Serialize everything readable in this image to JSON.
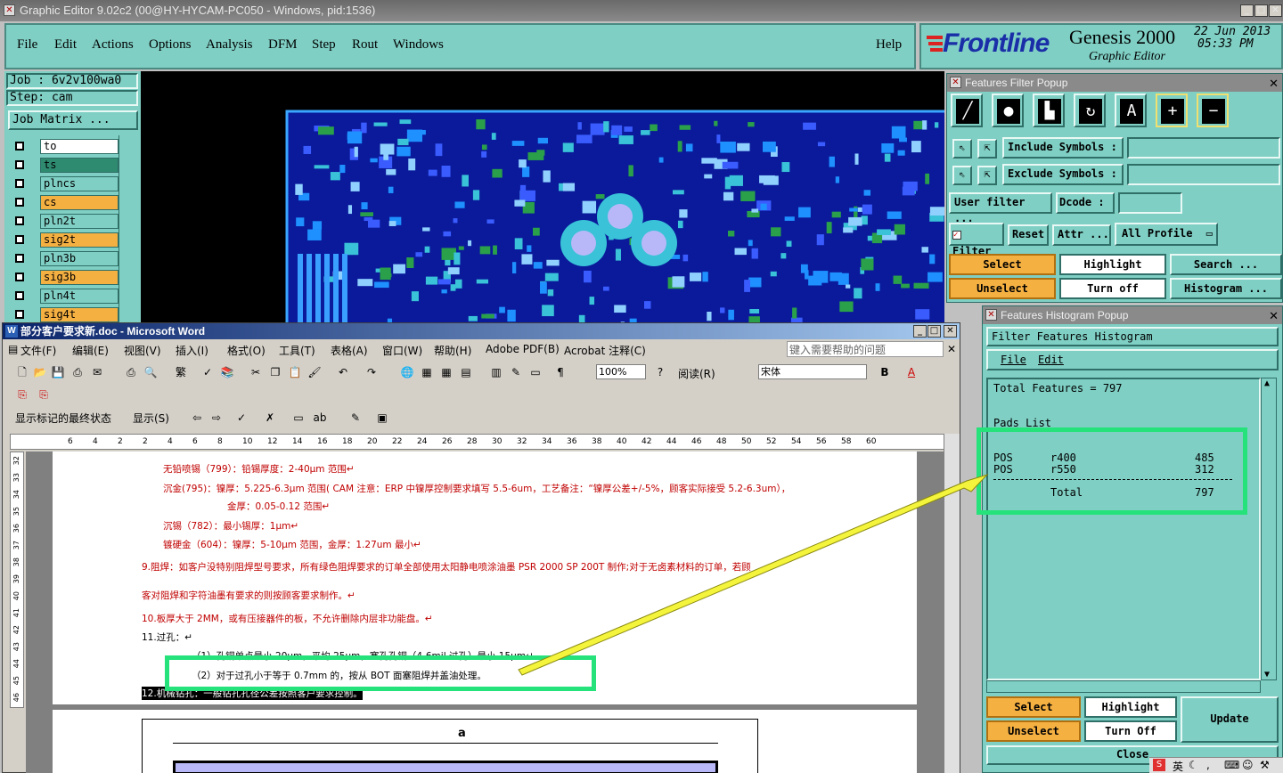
{
  "genesis": {
    "title": "Graphic Editor 9.02c2 (00@HY-HYCAM-PC050 - Windows, pid:1536)",
    "menu": [
      "File",
      "Edit",
      "Actions",
      "Options",
      "Analysis",
      "DFM",
      "Step",
      "Rout",
      "Windows"
    ],
    "help": "Help",
    "logo": "Frontline",
    "product": "Genesis 2000",
    "subtitle": "Graphic Editor",
    "date": "22 Jun 2013",
    "time": "05:33 PM",
    "job": "Job : 6v2v100wa0",
    "step": "Step: cam",
    "job_matrix": "Job Matrix ...",
    "layers": [
      {
        "name": "to",
        "color": "#ffffff"
      },
      {
        "name": "ts",
        "color": "#2e8b70"
      },
      {
        "name": "plncs",
        "color": "#7fcfc4"
      },
      {
        "name": "cs",
        "color": "#f5b042"
      },
      {
        "name": "pln2t",
        "color": "#7fcfc4"
      },
      {
        "name": "sig2t",
        "color": "#f5b042"
      },
      {
        "name": "pln3b",
        "color": "#7fcfc4"
      },
      {
        "name": "sig3b",
        "color": "#f5b042"
      },
      {
        "name": "pln4t",
        "color": "#7fcfc4"
      },
      {
        "name": "sig4t",
        "color": "#f5b042"
      }
    ]
  },
  "filter_popup": {
    "title": "Features Filter Popup",
    "include": "Include Symbols :",
    "exclude": "Exclude Symbols :",
    "user_filter": "User filter ...",
    "dcode": "Dcode :",
    "filter": "Filter",
    "reset": "Reset",
    "attr": "Attr ...",
    "profile": "All Profile",
    "select": "Select",
    "highlight": "Highlight",
    "search": "Search ...",
    "unselect": "Unselect",
    "turn_off": "Turn off",
    "histogram": "Histogram ..."
  },
  "histogram_popup": {
    "title": "Features Histogram Popup",
    "header": "Filter Features Histogram",
    "menu": [
      "File",
      "Edit"
    ],
    "total_line": "Total Features = 797",
    "pads_list": "Pads List",
    "rows": [
      {
        "type": "POS",
        "symbol": "r400",
        "count": "485"
      },
      {
        "type": "POS",
        "symbol": "r550",
        "count": "312"
      }
    ],
    "total_label": "Total",
    "total_value": "797",
    "select": "Select",
    "highlight": "Highlight",
    "update": "Update",
    "unselect": "Unselect",
    "turn_off": "Turn Off",
    "close": "Close"
  },
  "word": {
    "title": "部分客户要求新.doc - Microsoft Word",
    "menu": [
      "文件(F)",
      "编辑(E)",
      "视图(V)",
      "插入(I)",
      "格式(O)",
      "工具(T)",
      "表格(A)",
      "窗口(W)",
      "帮助(H)",
      "Adobe PDF(B)",
      "Acrobat 注释(C)"
    ],
    "help_box": "键入需要帮助的问题",
    "zoom": "100%",
    "read": "阅读(R)",
    "font": "宋体",
    "markup": "显示标记的最终状态",
    "show": "显示(S)",
    "ruler_ticks": [
      "6",
      "4",
      "2",
      "2",
      "4",
      "6",
      "8",
      "10",
      "12",
      "14",
      "16",
      "18",
      "20",
      "22",
      "24",
      "26",
      "28",
      "30",
      "32",
      "34",
      "36",
      "38",
      "40",
      "42",
      "44",
      "46",
      "48",
      "50",
      "52",
      "54",
      "56",
      "58",
      "60"
    ],
    "vruler_ticks": [
      "32",
      "33",
      "34",
      "35",
      "36",
      "37",
      "38",
      "39",
      "40",
      "41",
      "42",
      "43",
      "44",
      "45",
      "46"
    ],
    "lines": [
      "无铅喷锡（799）：铅锡厚度：2-40μm 范围↵",
      "沉金(795)：镍厚：5.225-6.3μm 范围( CAM 注意：ERP 中镍厚控制要求填写 5.5-6um，工艺备注：“镍厚公差+/-5%，顾客实际接受 5.2-6.3um），",
      "金厚：0.05-0.12 范围↵",
      "沉锡（782）：最小锡厚：1μm↵",
      "镀硬金（604）：镍厚：5-10μm 范围，金厚：1.27um 最小↵",
      "9.阻焊：如客户没特别阻焊型号要求，所有绿色阻焊要求的订单全部使用太阳静电喷涂油墨 PSR 2000 SP 200T 制作;对于无卤素材料的订单，若顾",
      "客对阻焊和字符油墨有要求的则按顾客要求制作。↵",
      "10.板厚大于 2MM，或有压接器件的板，不允许删除内层非功能盘。↵",
      "11.过孔：↵",
      "（1）孔铜单点最小 20μm，平均 25μm，塞孔孔铜（4-6mil 过孔）最小 15μm↵",
      "（2）对于过孔小于等于 0.7mm 的，按从 BOT 面塞阻焊并盖油处理。",
      "12.机械钻孔：一般钻孔孔径公差按照客户要求控制。"
    ],
    "diagram_label": "a"
  },
  "tray": {
    "ime": "英"
  }
}
